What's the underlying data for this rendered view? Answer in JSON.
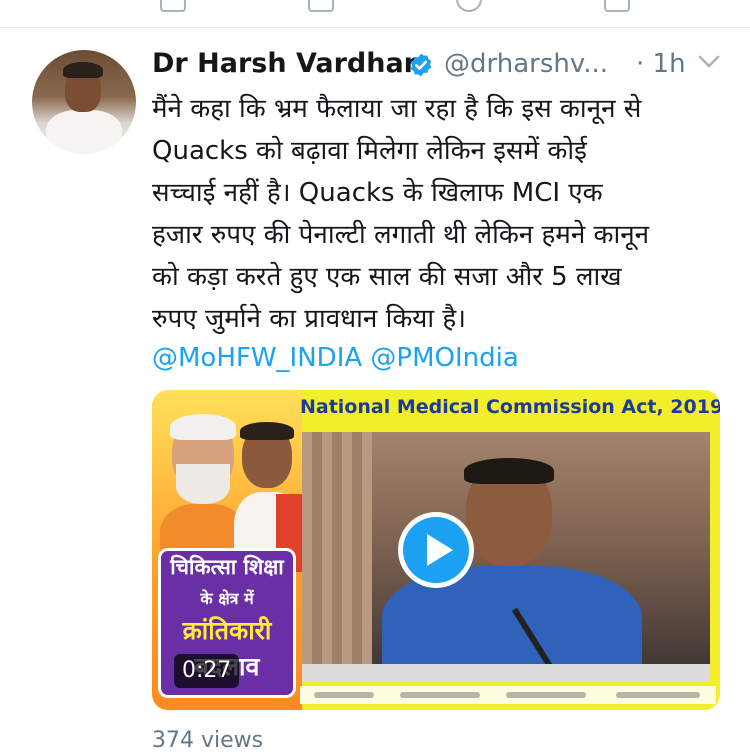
{
  "tweet": {
    "author_name": "Dr Harsh Vardhan",
    "handle": "@drharshv...",
    "time": "· 1h",
    "text_lines": [
      "मैंने कहा कि भ्रम फैलाया जा रहा है कि इस कानून से",
      "Quacks को बढ़ावा मिलेगा लेकिन इसमें कोई",
      "सच्चाई नहीं है। Quacks के खिलाफ MCI एक",
      "हजार रुपए की पेनाल्टी लगाती थी लेकिन हमने कानून",
      "को कड़ा करते हुए एक साल की सजा और 5 लाख",
      "रुपए जुर्माने का प्रावधान किया है।"
    ],
    "mentions": [
      "@MoHFW_INDIA",
      "@PMOIndia"
    ],
    "media": {
      "title": "National Medical Commission Act, 2019",
      "promo_line1": "चिकित्सा शिक्षा",
      "promo_line2": "के क्षेत्र में",
      "promo_line3": "क्रांतिकारी",
      "promo_line4": "बदलाव",
      "duration": "0:27"
    },
    "views": "374 views"
  },
  "colors": {
    "link": "#1da1f2",
    "secondary_text": "#657786",
    "verified_badge": "#1da1f2",
    "media_background": "#f3ee2a",
    "promo_box": "#6b2fa5",
    "title_text": "#1e3b9a"
  },
  "icons": {
    "verified": "verified-badge-icon",
    "more": "chevron-down-icon",
    "play": "play-icon"
  }
}
